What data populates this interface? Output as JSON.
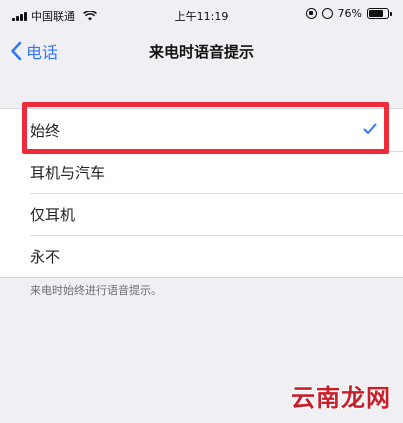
{
  "status_bar": {
    "carrier": "中国联通",
    "time": "上午11:19",
    "battery": "76%",
    "battery_level": 0.76,
    "icons": [
      "signal-icon",
      "wifi-icon",
      "rotation-lock-icon",
      "alarm-icon",
      "battery-icon"
    ]
  },
  "nav": {
    "back_label": "电话",
    "title": "来电时语音提示"
  },
  "options": [
    {
      "label": "始终",
      "selected": true
    },
    {
      "label": "耳机与汽车",
      "selected": false
    },
    {
      "label": "仅耳机",
      "selected": false
    },
    {
      "label": "永不",
      "selected": false
    }
  ],
  "footer_note": "来电时始终进行语音提示。",
  "watermark": "云南龙网",
  "colors": {
    "accent": "#3478f6",
    "highlight": "#ee2b3b",
    "background": "#efeff4",
    "watermark": "#c91f2a"
  }
}
